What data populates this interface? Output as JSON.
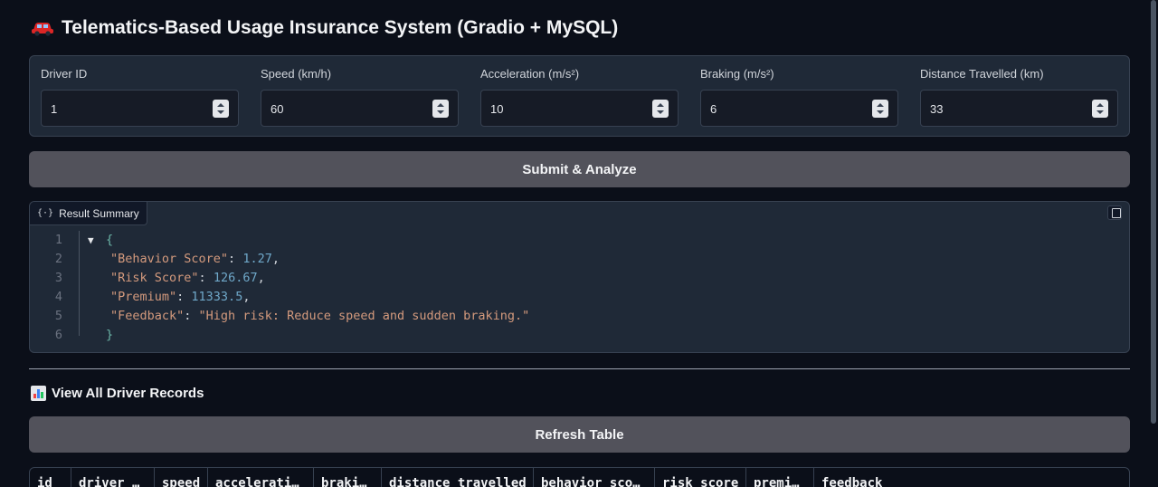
{
  "header": {
    "title": "Telematics-Based Usage Insurance System (Gradio + MySQL)",
    "icon": "car-icon"
  },
  "inputs": [
    {
      "label": "Driver ID",
      "value": "1"
    },
    {
      "label": "Speed (km/h)",
      "value": "60"
    },
    {
      "label": "Acceleration (m/s²)",
      "value": "10"
    },
    {
      "label": "Braking (m/s²)",
      "value": "6"
    },
    {
      "label": "Distance Travelled (km)",
      "value": "33"
    }
  ],
  "submit_button": {
    "label": "Submit & Analyze"
  },
  "result": {
    "label": "Result Summary",
    "line_numbers": [
      "1",
      "2",
      "3",
      "4",
      "5",
      "6"
    ],
    "open_brace": "{",
    "close_brace": "}",
    "fields": [
      {
        "key": "\"Behavior Score\"",
        "value": "1.27",
        "type": "number",
        "comma": ","
      },
      {
        "key": "\"Risk Score\"",
        "value": "126.67",
        "type": "number",
        "comma": ","
      },
      {
        "key": "\"Premium\"",
        "value": "11333.5",
        "type": "number",
        "comma": ","
      },
      {
        "key": "\"Feedback\"",
        "value": "\"High risk: Reduce speed and sudden braking.\"",
        "type": "string",
        "comma": ""
      }
    ]
  },
  "records": {
    "title": "View All Driver Records",
    "icon": "bar-chart-icon",
    "refresh_label": "Refresh Table",
    "columns": [
      "id",
      "driver_…",
      "speed",
      "accelerati…",
      "braki…",
      "distance_travelled",
      "behavior_sco…",
      "risk_score",
      "premi…",
      "feedback"
    ]
  },
  "colors": {
    "background": "#0b0f19",
    "panel": "#1f2937",
    "button": "#52525b",
    "json_key": "#d49a7d",
    "json_number": "#6fa8c9"
  }
}
